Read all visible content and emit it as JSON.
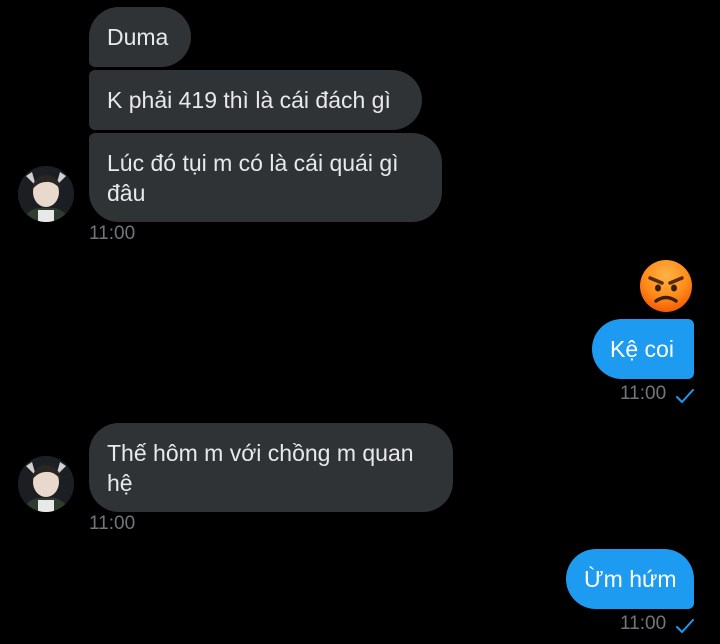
{
  "conversation": {
    "messages": [
      {
        "text": "Duma"
      },
      {
        "text": "K phải 419 thì là cái đách gì"
      },
      {
        "text": "Lúc đó tụi m có là cái quái gì đâu"
      },
      {
        "time": "11:00"
      },
      {
        "emoji": "angry-face"
      },
      {
        "text": "Kệ coi"
      },
      {
        "time": "11:00"
      },
      {
        "text": "Thế hôm m với chồng m quan hệ"
      },
      {
        "time": "11:00"
      },
      {
        "text": "Ừm hứm"
      },
      {
        "time": "11:00"
      }
    ]
  },
  "colors": {
    "background": "#000000",
    "incoming_bubble": "#2f3336",
    "outgoing_bubble": "#1d9bf0",
    "timestamp": "#71767b",
    "read_check": "#1d9bf0"
  }
}
